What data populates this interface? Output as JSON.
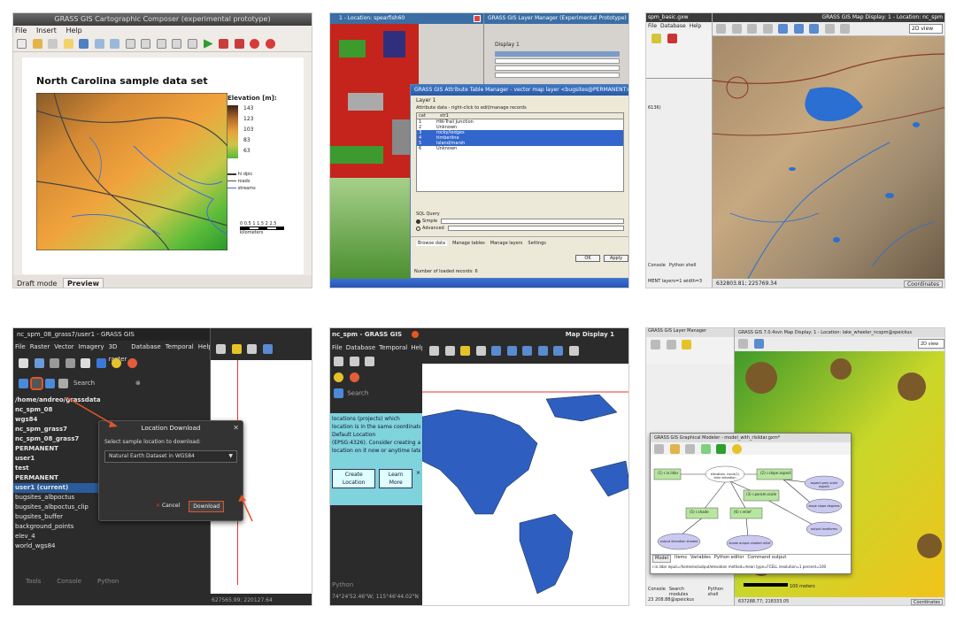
{
  "tile1": {
    "window_title": "GRASS GIS Cartographic Composer (experimental prototype)",
    "menu": [
      "File",
      "Insert",
      "Help"
    ],
    "map_title": "North Carolina sample data set",
    "legend_title": "Elevation [m]:",
    "legend_values": [
      "143",
      "123",
      "103",
      "83",
      "63"
    ],
    "legend_lines": [
      "hi dpic",
      "roads",
      "streams"
    ],
    "scale_ticks": [
      "0",
      "0.5",
      "1",
      "1.5",
      "2",
      "2.5"
    ],
    "scale_unit": "kilometers",
    "tabs": [
      "Draft mode",
      "Preview"
    ]
  },
  "tile2": {
    "window_title_left": "1 - Location: spearfish60",
    "window_title_right": "GRASS GIS Layer Manager (Experimental Prototype)",
    "display_label": "Display 1",
    "attr_title": "GRASS GIS Attribute Table Manager - vector map layer <bugsites@PERMANENT>",
    "attr_tab": "Layer 1",
    "attr_hint": "Attribute data - right-click to edit/manage records",
    "attr_columns": [
      "cat",
      "str1"
    ],
    "attr_rows": [
      [
        "1",
        "HW-Trail Junction"
      ],
      [
        "2",
        "Unknown"
      ],
      [
        "3",
        "rocky/ledges"
      ],
      [
        "4",
        "timberline"
      ],
      [
        "5",
        "Island/marsh"
      ],
      [
        "6",
        "Unknown"
      ]
    ],
    "sql_label": "SQL Query",
    "sql_simple": "Simple",
    "sql_advanced": "Advanced",
    "bottom_tabs": [
      "Browse data",
      "Manage tables",
      "Manage layers",
      "Settings"
    ],
    "ok_label": "OK",
    "apply_label": "Apply",
    "status_text": "Number of loaded records: 6"
  },
  "tile3": {
    "title_left": "spm_basic.gxw",
    "title_right": "GRASS GIS Map Display: 1 - Location: nc_spm",
    "menu": [
      "File",
      "Database",
      "Help"
    ],
    "view_select": "2D view",
    "console_tabs": [
      "Console",
      "Python shell"
    ],
    "status_left": "MENT layers=1 width=3",
    "coords": "632803.81; 225769.34",
    "coords_mode": "Coordinates",
    "side_value": "6136)"
  },
  "tile4": {
    "window_title": "nc_spm_08_grass7/user1 - GRASS GIS",
    "menu": [
      "File",
      "Raster",
      "Vector",
      "Imagery",
      "3D raster",
      "Database",
      "Temporal",
      "Help"
    ],
    "search_placeholder": "Search",
    "tree": [
      "/home/andreo/grassdata",
      "nc_spm_08",
      "wgs84",
      "nc_spm_grass7",
      "nc_spm_08_grass7",
      "PERMANENT",
      "user1",
      "test",
      "PERMANENT",
      "user1 (current)",
      "bugsites_albpoctus",
      "bugsites_albpoctus_clip",
      "bugsites_buffer",
      "background_points",
      "elev_4",
      "world_wgs84"
    ],
    "bottom_tabs": [
      "Tools",
      "Console",
      "Python"
    ],
    "coords": "627565.99; 220127.64",
    "dialog": {
      "title": "Location Download",
      "prompt": "Select sample location to download:",
      "selected": "Natural Earth Dataset in WGS84",
      "cancel": "Cancel",
      "download": "Download"
    }
  },
  "tile5": {
    "window_title": "nc_spm - GRASS GIS",
    "display_title": "Map Display 1",
    "menu": [
      "File",
      "Database",
      "Temporal",
      "Help"
    ],
    "search_placeholder": "Search",
    "info_lines": [
      "locations (projects) which",
      "location is in the same coordinate",
      "",
      "Default Location",
      "(EPSG:4326). Consider creating a new",
      "location on it now or anytime later"
    ],
    "buttons": [
      "Create Location",
      "Learn More"
    ],
    "close": "×",
    "console_tab": "Python",
    "coords": "74°24'52.46\"W; 115°46'44.02\"N"
  },
  "tile6": {
    "title_main": "GRASS GIS 7.0.4svn Map Display: 1 - Location: lake_wheeler_ncspm@speickus",
    "title_left": "GRASS GIS Layer Manager",
    "view_select": "2D view",
    "modeler_title": "GRASS GIS Graphical Modeler - model_with_rlslidar.gxm*",
    "nodes_green": [
      "(1) r.in.lidar",
      "(2) r.slope.aspect",
      "(3) r.param.scale",
      "(5) r.shade",
      "(6) r.relief"
    ],
    "nodes_oval": [
      "elevation, input(1) lidar elevation",
      "aspect grey scale aspect",
      "slope slope degrees",
      "output landforms",
      "output elevation shaded",
      "shade output shaded relief"
    ],
    "modeler_tabs": [
      "Model",
      "Items",
      "Variables",
      "Python editor",
      "Command output"
    ],
    "modeler_cmd": "r.in.lidar input=/home/ex/output/elevation method=mean type=FCELL resolution=1 percent=100",
    "bottom_tabs": [
      "Console",
      "Search modules",
      "Python shell"
    ],
    "scale_label": "100 meters",
    "coords": "637288.77; 218333.05",
    "coords_mode": "Coordinates",
    "left_status": "23 208.88@speickus"
  }
}
